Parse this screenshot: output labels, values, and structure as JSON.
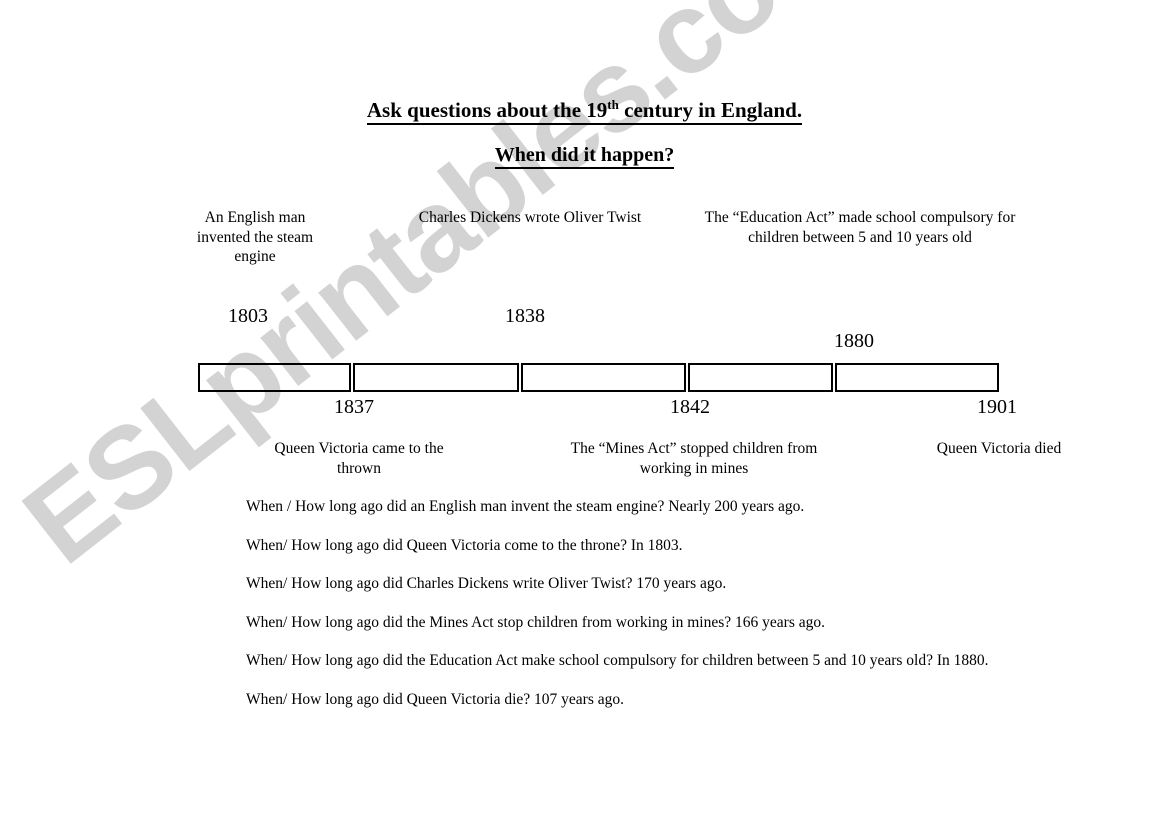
{
  "page": {
    "background_color": "#ffffff",
    "ink_color": "#000000"
  },
  "watermark": {
    "text": "ESLprintables.com",
    "color": "#cccccc"
  },
  "header": {
    "title_part1": "Ask questions about the 19",
    "title_superscript": "th",
    "title_part2": " century in England.",
    "subtitle": "When did it happen?"
  },
  "timeline": {
    "events_above": [
      {
        "caption": "An English man invented the steam engine",
        "year": "1803"
      },
      {
        "caption": "Charles Dickens wrote Oliver Twist",
        "year": "1838"
      },
      {
        "caption": "The “Education Act” made school compulsory for children between 5 and 10 years old",
        "year": "1880"
      }
    ],
    "events_below": [
      {
        "year": "1837",
        "caption": "Queen Victoria came to the thrown"
      },
      {
        "year": "1842",
        "caption": "The “Mines Act” stopped children from working in mines"
      },
      {
        "year": "1901",
        "caption": "Queen Victoria died"
      }
    ],
    "segment_count": 5
  },
  "questions": [
    "When / How long ago did an English man invent the steam engine? Nearly 200 years ago.",
    "When/ How long ago did Queen Victoria come to the throne? In 1803.",
    "When/ How long ago did Charles Dickens write Oliver Twist? 170 years ago.",
    "When/ How long ago did the Mines Act stop children from working in mines? 166 years ago.",
    "When/ How long ago did the Education Act make school compulsory for children between 5 and 10 years old? In 1880.",
    "When/ How long ago did Queen Victoria die? 107 years ago."
  ]
}
